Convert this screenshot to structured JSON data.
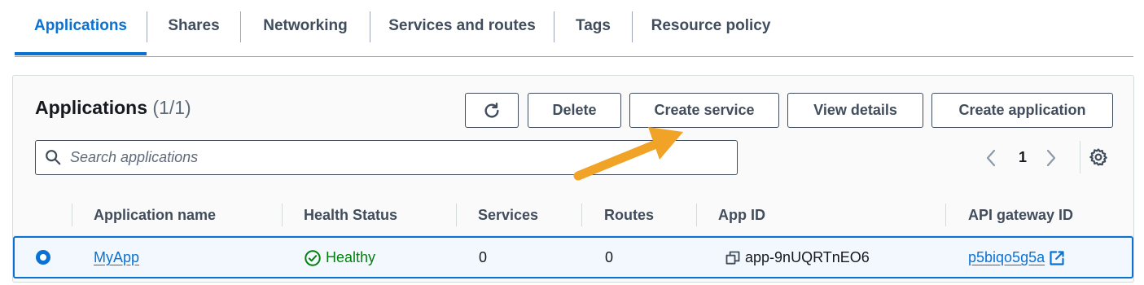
{
  "tabs": [
    {
      "label": "Applications",
      "active": true
    },
    {
      "label": "Shares"
    },
    {
      "label": "Networking"
    },
    {
      "label": "Services and routes"
    },
    {
      "label": "Tags"
    },
    {
      "label": "Resource policy"
    }
  ],
  "panel": {
    "title": "Applications",
    "count": "(1/1)"
  },
  "buttons": {
    "refresh_icon": "refresh-icon",
    "delete": "Delete",
    "create_service": "Create service",
    "view_details": "View details",
    "create_application": "Create application"
  },
  "search": {
    "placeholder": "Search applications",
    "value": ""
  },
  "pagination": {
    "current_page": "1"
  },
  "table": {
    "columns": [
      "Application name",
      "Health Status",
      "Services",
      "Routes",
      "App ID",
      "API gateway ID"
    ],
    "rows": [
      {
        "selected": true,
        "name": "MyApp",
        "health": "Healthy",
        "services": "0",
        "routes": "0",
        "app_id": "app-9nUQRTnEO6",
        "api_gateway_id": "p5biqo5g5a"
      }
    ]
  },
  "colors": {
    "accent": "#0972d3",
    "healthy": "#037f0c",
    "annotation_arrow": "#f0a327"
  }
}
